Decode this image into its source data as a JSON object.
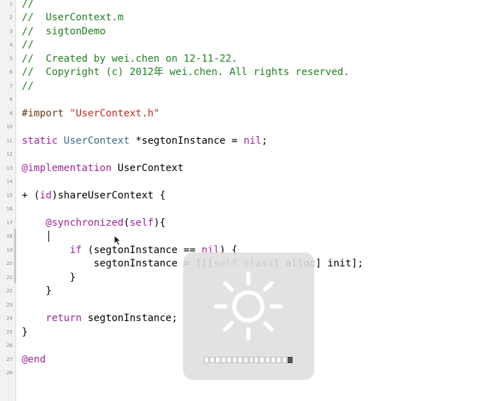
{
  "editor": {
    "file_name": "UserContext.m",
    "colors": {
      "comment": "#1f7f1f",
      "keyword": "#a0249b",
      "string": "#c1291e",
      "class": "#3d6e85",
      "plain": "#000000"
    },
    "lines": [
      {
        "num": "1",
        "tokens": [
          {
            "t": "//",
            "c": "comment"
          }
        ]
      },
      {
        "num": "2",
        "tokens": [
          {
            "t": "//  UserContext.m",
            "c": "comment"
          }
        ]
      },
      {
        "num": "3",
        "tokens": [
          {
            "t": "//  sigtonDemo",
            "c": "comment"
          }
        ]
      },
      {
        "num": "4",
        "tokens": [
          {
            "t": "//",
            "c": "comment"
          }
        ]
      },
      {
        "num": "5",
        "tokens": [
          {
            "t": "//  Created by wei.chen on 12-11-22.",
            "c": "comment"
          }
        ]
      },
      {
        "num": "6",
        "tokens": [
          {
            "t": "//  Copyright (c) 2012年 wei.chen. All rights reserved.",
            "c": "comment"
          }
        ]
      },
      {
        "num": "7",
        "tokens": [
          {
            "t": "//",
            "c": "comment"
          }
        ]
      },
      {
        "num": "8",
        "tokens": []
      },
      {
        "num": "9",
        "tokens": [
          {
            "t": "#import ",
            "c": "keyword_dark"
          },
          {
            "t": "\"UserContext.h\"",
            "c": "string"
          }
        ]
      },
      {
        "num": "10",
        "tokens": []
      },
      {
        "num": "11",
        "tokens": [
          {
            "t": "static ",
            "c": "keyword"
          },
          {
            "t": "UserContext",
            "c": "class"
          },
          {
            "t": " *segtonInstance = ",
            "c": "plain"
          },
          {
            "t": "nil",
            "c": "keyword"
          },
          {
            "t": ";",
            "c": "plain"
          }
        ]
      },
      {
        "num": "12",
        "tokens": []
      },
      {
        "num": "13",
        "tokens": [
          {
            "t": "@implementation",
            "c": "keyword"
          },
          {
            "t": " UserContext",
            "c": "plain"
          }
        ]
      },
      {
        "num": "14",
        "tokens": []
      },
      {
        "num": "15",
        "tokens": [
          {
            "t": "+ (",
            "c": "plain"
          },
          {
            "t": "id",
            "c": "keyword"
          },
          {
            "t": ")shareUserContext {",
            "c": "plain"
          }
        ]
      },
      {
        "num": "16",
        "tokens": []
      },
      {
        "num": "17",
        "tokens": [
          {
            "t": "    ",
            "c": "plain"
          },
          {
            "t": "@synchronized",
            "c": "keyword"
          },
          {
            "t": "(",
            "c": "plain"
          },
          {
            "t": "self",
            "c": "keyword"
          },
          {
            "t": "){",
            "c": "plain"
          }
        ]
      },
      {
        "num": "18",
        "tokens": []
      },
      {
        "num": "19",
        "tokens": [
          {
            "t": "        ",
            "c": "plain"
          },
          {
            "t": "if",
            "c": "keyword"
          },
          {
            "t": " (segtonInstance == ",
            "c": "plain"
          },
          {
            "t": "nil",
            "c": "keyword"
          },
          {
            "t": ") {",
            "c": "plain"
          }
        ]
      },
      {
        "num": "20",
        "tokens": [
          {
            "t": "            segtonInstance = [[[",
            "c": "plain"
          },
          {
            "t": "self",
            "c": "keyword"
          },
          {
            "t": " ",
            "c": "plain"
          },
          {
            "t": "class",
            "c": "keyword"
          },
          {
            "t": "] alloc] init];",
            "c": "plain"
          }
        ]
      },
      {
        "num": "21",
        "tokens": [
          {
            "t": "        }",
            "c": "plain"
          }
        ]
      },
      {
        "num": "22",
        "tokens": [
          {
            "t": "    }",
            "c": "plain"
          }
        ]
      },
      {
        "num": "23",
        "tokens": []
      },
      {
        "num": "24",
        "tokens": [
          {
            "t": "    ",
            "c": "plain"
          },
          {
            "t": "return",
            "c": "keyword"
          },
          {
            "t": " segtonInstance;",
            "c": "plain"
          }
        ]
      },
      {
        "num": "25",
        "tokens": [
          {
            "t": "}",
            "c": "plain"
          }
        ]
      },
      {
        "num": "26",
        "tokens": []
      },
      {
        "num": "27",
        "tokens": [
          {
            "t": "@end",
            "c": "keyword"
          }
        ]
      },
      {
        "num": "28",
        "tokens": []
      }
    ]
  },
  "brightness_hud": {
    "icon": "sun-icon",
    "level_segments_total": 16,
    "level_segments_filled": 16,
    "level_fraction": 1.0
  }
}
